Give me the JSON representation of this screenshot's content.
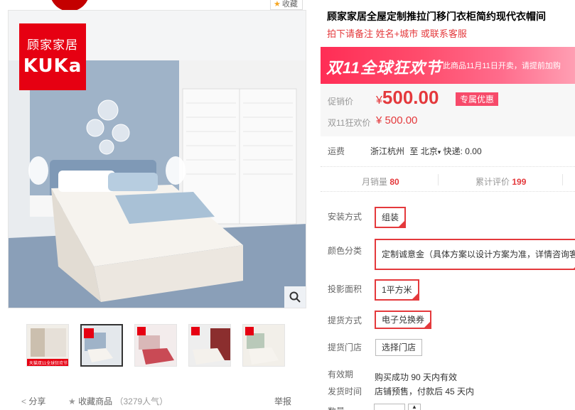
{
  "favorite": {
    "label": "收藏"
  },
  "logo": {
    "cn": "顾家家居",
    "en": "KUKa"
  },
  "product": {
    "title": "顾家家居全屋定制推拉门移门衣柜简约现代衣帽间",
    "subtitle": "拍下请备注 姓名+城市 或联系客服"
  },
  "banner": {
    "big": "双11全球狂欢节",
    "small": "此商品11月11日开卖，请提前加购"
  },
  "thumb1_caption": "天猫双11全球狂欢节",
  "price": {
    "promo_label": "促销价",
    "currency": "¥",
    "promo_value": "500.00",
    "badge": "专属优惠",
    "d11_label": "双11狂欢价",
    "d11_value": "¥ 500.00"
  },
  "shipping": {
    "label": "运费",
    "from": "浙江杭州",
    "to_prefix": "至",
    "to": "北京",
    "express": "快递: 0.00"
  },
  "stats": {
    "monthly_label": "月销量",
    "monthly_value": "80",
    "review_label": "累计评价",
    "review_value": "199"
  },
  "options": {
    "install": {
      "label": "安装方式",
      "value": "组装"
    },
    "color": {
      "label": "颜色分类",
      "value": "定制诚意金（具体方案以设计方案为准，详情咨询客服）"
    },
    "area": {
      "label": "投影面积",
      "value": "1平方米"
    },
    "pickup": {
      "label": "提货方式",
      "value": "电子兑换券"
    },
    "store": {
      "label": "提货门店",
      "value": "选择门店"
    }
  },
  "validity": {
    "label": "有效期",
    "value": "购买成功 90 天内有效"
  },
  "dispatch": {
    "label": "发货时间",
    "value": "店铺预售，付款后 45 天内"
  },
  "quantity": {
    "label": "数量"
  },
  "share": {
    "share": "分享",
    "collect": "收藏商品",
    "popularity": "（3279人气）",
    "report": "举报"
  },
  "colors": {
    "accent": "#e4393c",
    "banner": "#ff2d55"
  }
}
